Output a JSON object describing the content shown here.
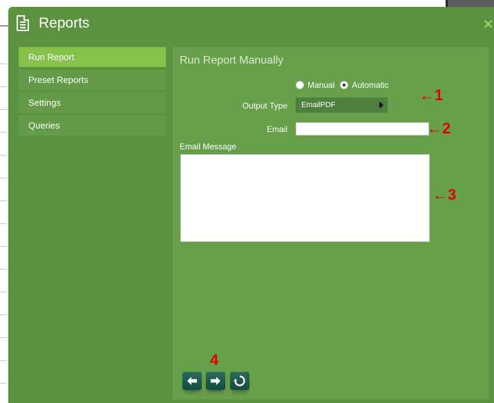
{
  "dialog": {
    "title": "Reports",
    "close_symbol": "✕"
  },
  "sidebar": {
    "items": [
      {
        "label": "Run Report",
        "active": true
      },
      {
        "label": "Preset Reports",
        "active": false
      },
      {
        "label": "Settings",
        "active": false
      },
      {
        "label": "Queries",
        "active": false
      }
    ]
  },
  "main": {
    "heading": "Run Report Manually",
    "mode": {
      "options": [
        {
          "label": "Manual",
          "checked": false
        },
        {
          "label": "Automatic",
          "checked": true
        }
      ]
    },
    "output_type": {
      "label": "Output Type",
      "value": "EmailPDF"
    },
    "email": {
      "label": "Email",
      "value": ""
    },
    "email_message": {
      "label": "Email Message",
      "value": ""
    },
    "nav_buttons": [
      {
        "icon": "arrow-left-icon"
      },
      {
        "icon": "arrow-right-icon"
      },
      {
        "icon": "refresh-icon"
      }
    ]
  },
  "annotations": {
    "a1": "←1",
    "a2": "←2",
    "a3": "←3",
    "a4": "4"
  },
  "colors": {
    "dialog_bg": "#5a9240",
    "panel_bg": "#67a04b",
    "active_item": "#86c24b",
    "close_icon": "#a9d76a",
    "annotation": "#e30000"
  }
}
